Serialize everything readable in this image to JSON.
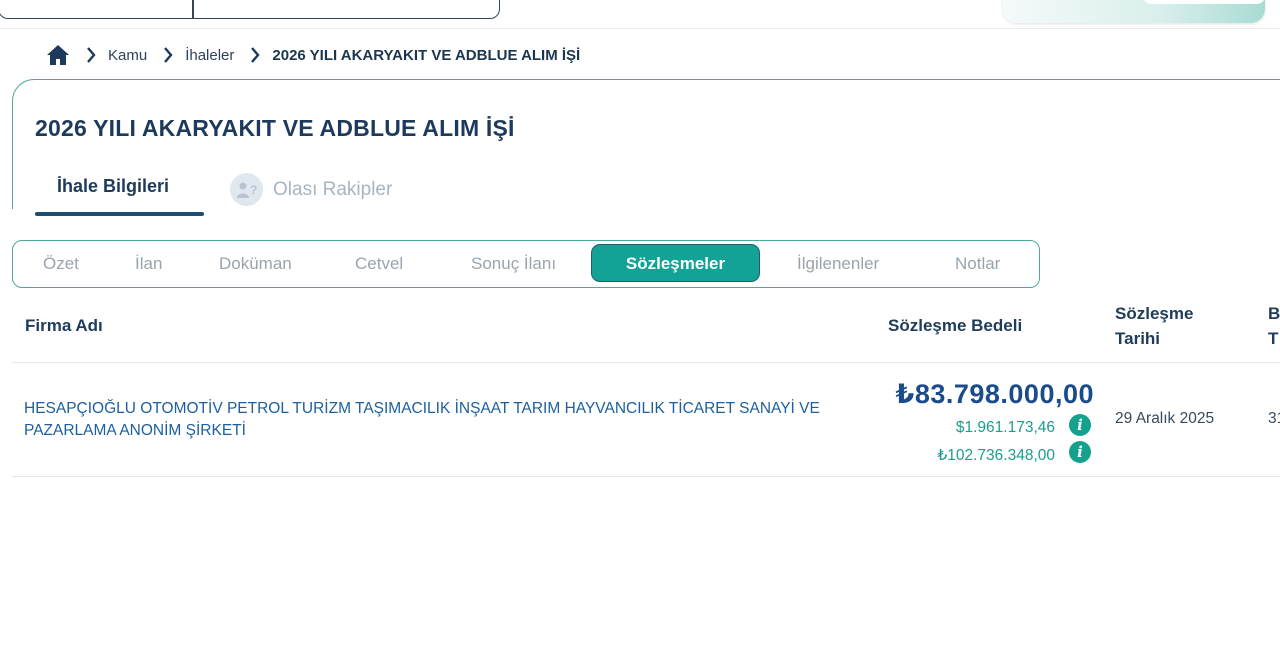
{
  "breadcrumb": {
    "items": [
      "Kamu",
      "İhaleler",
      "2026 YILI AKARYAKIT VE ADBLUE ALIM İŞİ"
    ]
  },
  "page": {
    "title": "2026 YILI AKARYAKIT VE ADBLUE ALIM İŞİ"
  },
  "main_tabs": [
    {
      "label": "İhale Bilgileri",
      "active": true
    },
    {
      "label": "Olası Rakipler",
      "active": false
    }
  ],
  "sub_tabs": [
    {
      "label": "Özet"
    },
    {
      "label": "İlan"
    },
    {
      "label": "Doküman"
    },
    {
      "label": "Cetvel"
    },
    {
      "label": "Sonuç İlanı"
    },
    {
      "label": "Sözleşmeler",
      "active": true
    },
    {
      "label": "İlgilenenler"
    },
    {
      "label": "Notlar"
    }
  ],
  "table": {
    "headers": {
      "firm": "Firma Adı",
      "amount": "Sözleşme Bedeli",
      "date_line1": "Sözleşme",
      "date_line2": "Tarihi",
      "next_line1": "B",
      "next_line2": "T"
    },
    "rows": [
      {
        "firm_line1": "HESAPÇIOĞLU OTOMOTİV PETROL TURİZM TAŞIMACILIK İNŞAAT TARIM HAYVANCILIK TİCARET SANAYİ VE",
        "firm_line2": "PAZARLAMA ANONİM ŞİRKETİ",
        "amount": "₺83.798.000,00",
        "amount_usd": "$1.961.173,46",
        "amount_try2": "₺102.736.348,00",
        "date": "29 Aralık 2025",
        "next": "31"
      }
    ]
  },
  "colors": {
    "accent": "#13a296",
    "brand_dark": "#1d3a5c",
    "link": "#1d5fa0"
  }
}
